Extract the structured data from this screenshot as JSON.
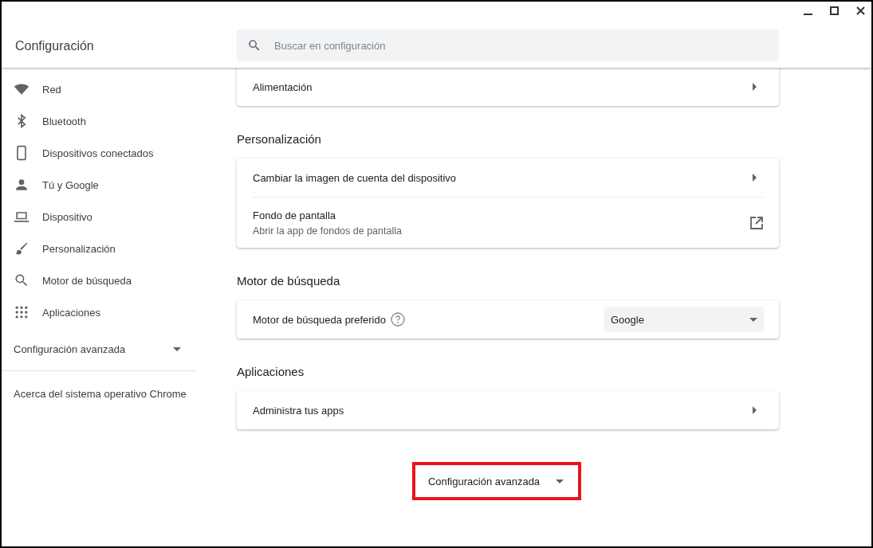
{
  "header": {
    "title": "Configuración",
    "search": {
      "placeholder": "Buscar en configuración"
    }
  },
  "sidebar": {
    "items": [
      {
        "label": "Red"
      },
      {
        "label": "Bluetooth"
      },
      {
        "label": "Dispositivos conectados"
      },
      {
        "label": "Tú y Google"
      },
      {
        "label": "Dispositivo"
      },
      {
        "label": "Personalización"
      },
      {
        "label": "Motor de búsqueda"
      },
      {
        "label": "Aplicaciones"
      }
    ],
    "advanced": "Configuración avanzada",
    "about": "Acerca del sistema operativo Chrome"
  },
  "sections": [
    {
      "rows": [
        {
          "kind": "link",
          "label": "Alimentación"
        }
      ]
    },
    {
      "heading": "Personalización",
      "rows": [
        {
          "kind": "link",
          "label": "Cambiar la imagen de cuenta del dispositivo"
        },
        {
          "kind": "external",
          "label": "Fondo de pantalla",
          "sublabel": "Abrir la app de fondos de pantalla"
        }
      ]
    },
    {
      "heading": "Motor de búsqueda",
      "rows": [
        {
          "kind": "select",
          "label": "Motor de búsqueda preferido",
          "value": "Google"
        }
      ]
    },
    {
      "heading": "Aplicaciones",
      "rows": [
        {
          "kind": "link",
          "label": "Administra tus apps"
        }
      ]
    }
  ],
  "advanced_button": {
    "label": "Configuración avanzada",
    "highlighted": true
  }
}
